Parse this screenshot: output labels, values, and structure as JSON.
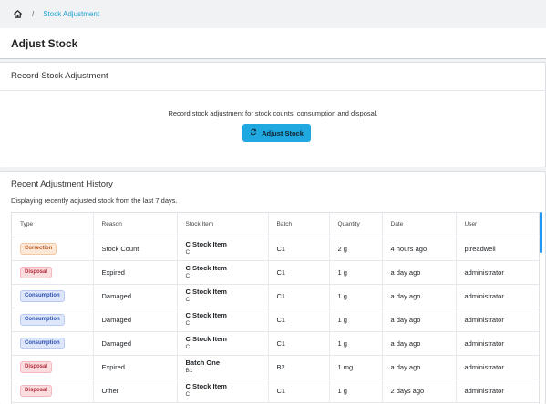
{
  "breadcrumb": {
    "separator": "/",
    "current": "Stock Adjustment"
  },
  "header": {
    "title": "Adjust Stock"
  },
  "record_card": {
    "title": "Record Stock Adjustment",
    "description": "Record stock adjustment for stock counts, consumption and disposal.",
    "button_label": "Adjust Stock"
  },
  "history_card": {
    "title": "Recent Adjustment History",
    "subtitle": "Displaying recently adjusted stock from the last 7 days."
  },
  "table": {
    "columns": [
      "Type",
      "Reason",
      "Stock Item",
      "Batch",
      "Quantity",
      "Date",
      "User"
    ],
    "rows": [
      {
        "type": "Correction",
        "reason": "Stock Count",
        "item": "C Stock Item",
        "code": "C",
        "batch": "C1",
        "quantity": "2 g",
        "date": "4 hours ago",
        "user": "ptreadwell"
      },
      {
        "type": "Disposal",
        "reason": "Expired",
        "item": "C Stock Item",
        "code": "C",
        "batch": "C1",
        "quantity": "1 g",
        "date": "a day ago",
        "user": "administrator"
      },
      {
        "type": "Consumption",
        "reason": "Damaged",
        "item": "C Stock Item",
        "code": "C",
        "batch": "C1",
        "quantity": "1 g",
        "date": "a day ago",
        "user": "administrator"
      },
      {
        "type": "Consumption",
        "reason": "Damaged",
        "item": "C Stock Item",
        "code": "C",
        "batch": "C1",
        "quantity": "1 g",
        "date": "a day ago",
        "user": "administrator"
      },
      {
        "type": "Consumption",
        "reason": "Damaged",
        "item": "C Stock Item",
        "code": "C",
        "batch": "C1",
        "quantity": "1 g",
        "date": "a day ago",
        "user": "administrator"
      },
      {
        "type": "Disposal",
        "reason": "Expired",
        "item": "Batch One",
        "code": "B1",
        "batch": "B2",
        "quantity": "1 mg",
        "date": "a day ago",
        "user": "administrator"
      },
      {
        "type": "Disposal",
        "reason": "Other",
        "item": "C Stock Item",
        "code": "C",
        "batch": "C1",
        "quantity": "1 g",
        "date": "2 days ago",
        "user": "administrator"
      }
    ]
  },
  "colors": {
    "accent": "#1ba3d6",
    "button": "#20a8e0"
  }
}
